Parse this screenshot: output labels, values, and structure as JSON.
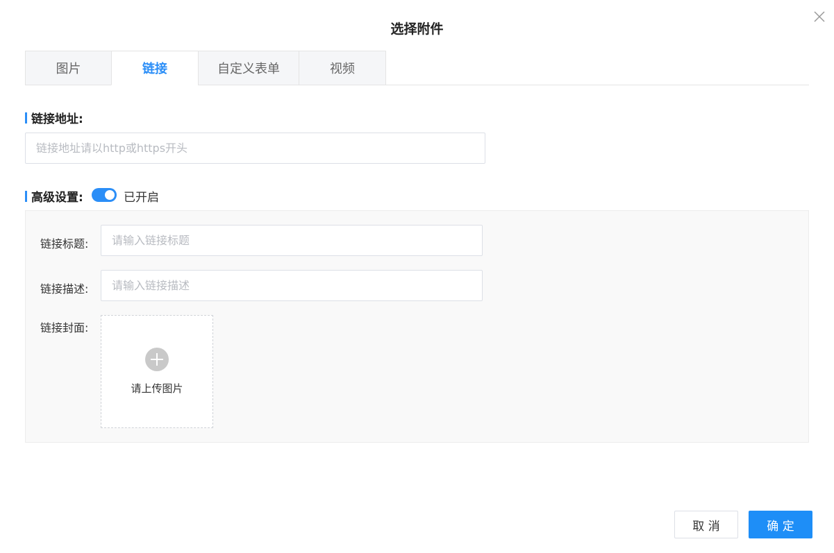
{
  "dialog": {
    "title": "选择附件"
  },
  "tabs": [
    {
      "label": "图片",
      "active": false
    },
    {
      "label": "链接",
      "active": true
    },
    {
      "label": "自定义表单",
      "active": false
    },
    {
      "label": "视频",
      "active": false
    }
  ],
  "link_url": {
    "label": "链接地址:",
    "value": "",
    "placeholder": "链接地址请以http或https开头"
  },
  "advanced": {
    "label": "高级设置:",
    "enabled": true,
    "status_text": "已开启",
    "title_field": {
      "label": "链接标题:",
      "value": "",
      "placeholder": "请输入链接标题"
    },
    "desc_field": {
      "label": "链接描述:",
      "value": "",
      "placeholder": "请输入链接描述"
    },
    "cover": {
      "label": "链接封面:",
      "upload_text": "请上传图片"
    }
  },
  "footer": {
    "cancel_label": "取 消",
    "ok_label": "确 定"
  },
  "colors": {
    "accent": "#2b8ef7",
    "primary_button": "#1e8ef7",
    "panel_bg": "#f9f9f9"
  },
  "icons": {
    "close": "close-icon",
    "upload": "plus-icon"
  }
}
